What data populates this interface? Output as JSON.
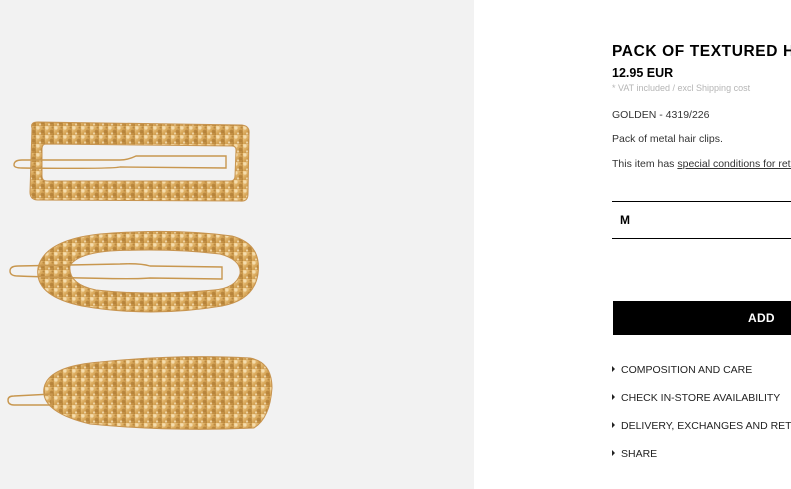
{
  "product": {
    "title": "PACK OF TEXTURED HAIR CLIPS",
    "price": "12.95 EUR",
    "vat_note": "* VAT included / excl Shipping cost",
    "reference": "GOLDEN - 4319/226",
    "description": "Pack of metal hair clips.",
    "conditions_prefix": "This item has ",
    "conditions_link": "special conditions for return"
  },
  "size_selector": {
    "selected": "M"
  },
  "add_button": {
    "label": "ADD"
  },
  "accordion": [
    {
      "label": "COMPOSITION AND CARE",
      "icon": "triangle-right-icon"
    },
    {
      "label": "CHECK IN-STORE AVAILABILITY",
      "icon": "triangle-right-icon"
    },
    {
      "label": "DELIVERY, EXCHANGES AND RETURNS",
      "icon": "triangle-right-icon"
    },
    {
      "label": "SHARE",
      "icon": "triangle-right-icon"
    }
  ],
  "colors": {
    "image_bg": "#f2f2f2",
    "gold": "#d9a95c",
    "button_bg": "#000000",
    "muted_text": "#b5b5b5"
  }
}
